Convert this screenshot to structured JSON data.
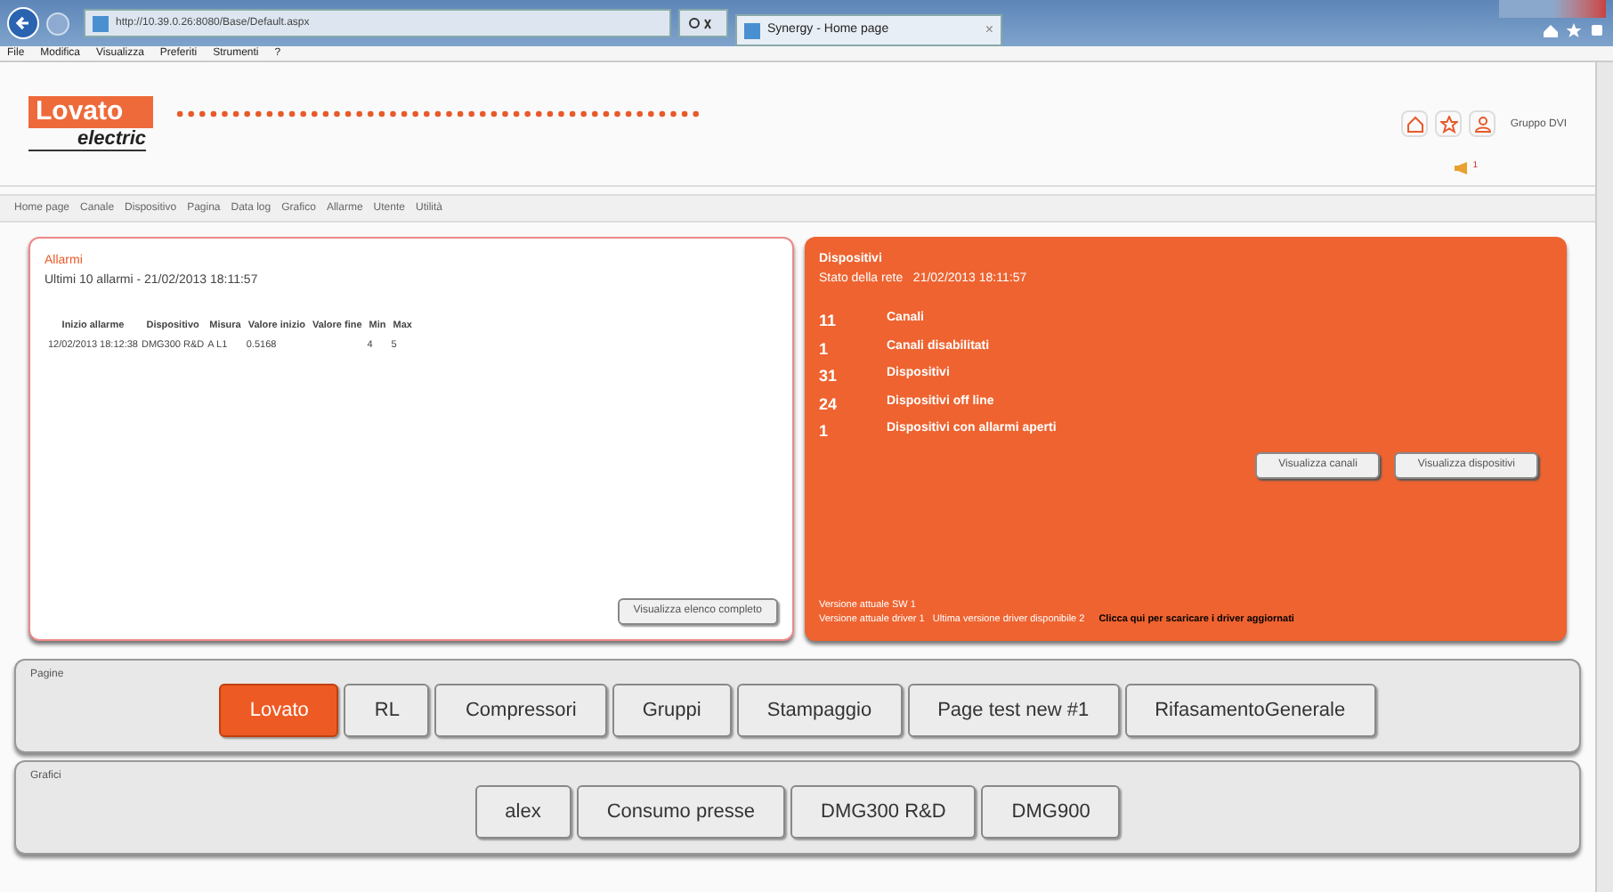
{
  "browser": {
    "url": "http://10.39.0.26:8080/Base/Default.aspx",
    "tab": "Synergy - Home page",
    "tab_close": "×",
    "menu": [
      "File",
      "Modifica",
      "Visualizza",
      "Preferiti",
      "Strumenti",
      "?"
    ]
  },
  "header": {
    "logo_top": "Lovato",
    "logo_bottom": "electric",
    "user": "Gruppo DVI",
    "notifications": "1"
  },
  "nav": [
    "Home page",
    "Canale",
    "Dispositivo",
    "Pagina",
    "Data log",
    "Grafico",
    "Allarme",
    "Utente",
    "Utilità"
  ],
  "alarms": {
    "title": "Allarmi",
    "subtitle": "Ultimi 10 allarmi - 21/02/2013 18:11:57",
    "columns": [
      "Inizio allarme",
      "Dispositivo",
      "Misura",
      "Valore inizio",
      "Valore fine",
      "Min",
      "Max"
    ],
    "rows": [
      [
        "12/02/2013 18:12:38",
        "DMG300 R&D",
        "A L1",
        "0.5168",
        "",
        "4",
        "5"
      ]
    ],
    "button": "Visualizza elenco completo"
  },
  "devices": {
    "title": "Dispositivi",
    "subtitle": "Stato della rete   21/02/2013 18:11:57",
    "stats": [
      {
        "count": "11",
        "label": "Canali"
      },
      {
        "count": "1",
        "label": "Canali disabilitati"
      },
      {
        "count": "31",
        "label": "Dispositivi"
      },
      {
        "count": "24",
        "label": "Dispositivi off line"
      },
      {
        "count": "1",
        "label": "Dispositivi con allarmi aperti"
      }
    ],
    "buttons": [
      "Visualizza canali",
      "Visualizza dispositivi"
    ],
    "version_sw": "Versione attuale SW 1",
    "version_driver": "Versione attuale driver 1   Ultima versione driver disponibile 2",
    "download_link": "Clicca qui per scaricare i driver aggiornati"
  },
  "pages": {
    "title": "Pagine",
    "items": [
      {
        "label": "Lovato",
        "selected": true
      },
      {
        "label": "RL",
        "selected": false
      },
      {
        "label": "Compressori",
        "selected": false
      },
      {
        "label": "Gruppi",
        "selected": false
      },
      {
        "label": "Stampaggio",
        "selected": false
      },
      {
        "label": "Page test new #1",
        "selected": false
      },
      {
        "label": "RifasamentoGenerale",
        "selected": false
      }
    ]
  },
  "charts": {
    "title": "Grafici",
    "items": [
      {
        "label": "alex",
        "selected": false
      },
      {
        "label": "Consumo presse",
        "selected": false
      },
      {
        "label": "DMG300 R&D",
        "selected": false
      },
      {
        "label": "DMG900",
        "selected": false
      }
    ]
  }
}
